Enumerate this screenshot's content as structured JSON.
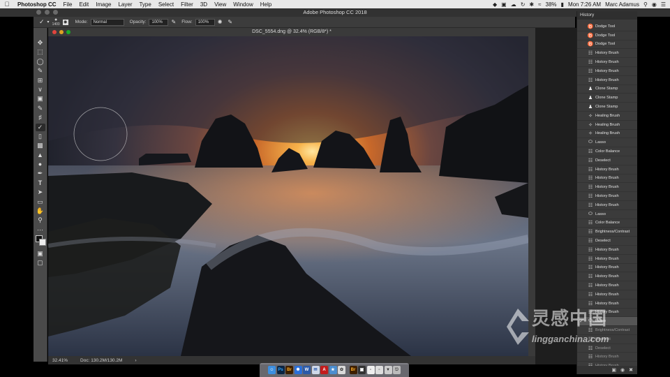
{
  "menubar": {
    "app_name": "Photoshop CC",
    "menus": [
      "File",
      "Edit",
      "Image",
      "Layer",
      "Type",
      "Select",
      "Filter",
      "3D",
      "View",
      "Window",
      "Help"
    ],
    "battery": "38%",
    "clock": "Mon 7:26 AM",
    "user": "Marc Adamus"
  },
  "app": {
    "title": "Adobe Photoshop CC 2018"
  },
  "options": {
    "brush_size": "1400",
    "mode_label": "Mode:",
    "mode_value": "Normal",
    "opacity_label": "Opacity:",
    "opacity_value": "100%",
    "flow_label": "Flow:",
    "flow_value": "100%"
  },
  "document": {
    "title": "DSC_5554.dng @ 32.4% (RGB/8*) *",
    "zoom": "32.41%",
    "doc_size": "Doc: 130.2M/130.2M"
  },
  "history": {
    "title": "History",
    "items": [
      {
        "label": "Dodge Tool",
        "icon": "dodge-icon"
      },
      {
        "label": "Dodge Tool",
        "icon": "dodge-icon"
      },
      {
        "label": "Dodge Tool",
        "icon": "dodge-icon"
      },
      {
        "label": "History Brush",
        "icon": "history-brush-icon"
      },
      {
        "label": "History Brush",
        "icon": "history-brush-icon"
      },
      {
        "label": "History Brush",
        "icon": "history-brush-icon"
      },
      {
        "label": "History Brush",
        "icon": "history-brush-icon"
      },
      {
        "label": "Clone Stamp",
        "icon": "clone-stamp-icon"
      },
      {
        "label": "Clone Stamp",
        "icon": "clone-stamp-icon"
      },
      {
        "label": "Clone Stamp",
        "icon": "clone-stamp-icon"
      },
      {
        "label": "Healing Brush",
        "icon": "healing-brush-icon"
      },
      {
        "label": "Healing Brush",
        "icon": "healing-brush-icon"
      },
      {
        "label": "Healing Brush",
        "icon": "healing-brush-icon"
      },
      {
        "label": "Lasso",
        "icon": "lasso-icon"
      },
      {
        "label": "Color Balance",
        "icon": "adjustment-icon"
      },
      {
        "label": "Deselect",
        "icon": "adjustment-icon"
      },
      {
        "label": "History Brush",
        "icon": "history-brush-icon"
      },
      {
        "label": "History Brush",
        "icon": "history-brush-icon"
      },
      {
        "label": "History Brush",
        "icon": "history-brush-icon"
      },
      {
        "label": "History Brush",
        "icon": "history-brush-icon"
      },
      {
        "label": "History Brush",
        "icon": "history-brush-icon"
      },
      {
        "label": "Lasso",
        "icon": "lasso-icon"
      },
      {
        "label": "Color Balance",
        "icon": "adjustment-icon"
      },
      {
        "label": "Brightness/Contrast",
        "icon": "adjustment-icon"
      },
      {
        "label": "Deselect",
        "icon": "adjustment-icon"
      },
      {
        "label": "History Brush",
        "icon": "history-brush-icon"
      },
      {
        "label": "History Brush",
        "icon": "history-brush-icon"
      },
      {
        "label": "History Brush",
        "icon": "history-brush-icon"
      },
      {
        "label": "History Brush",
        "icon": "history-brush-icon"
      },
      {
        "label": "History Brush",
        "icon": "history-brush-icon"
      },
      {
        "label": "History Brush",
        "icon": "history-brush-icon"
      },
      {
        "label": "History Brush",
        "icon": "history-brush-icon"
      },
      {
        "label": "History Brush",
        "icon": "history-brush-icon"
      },
      {
        "label": "Lasso",
        "icon": "lasso-icon"
      },
      {
        "label": "Brightness/Contrast",
        "icon": "adjustment-icon"
      },
      {
        "label": "Deselect",
        "icon": "adjustment-icon"
      },
      {
        "label": "Deselect",
        "icon": "adjustment-icon"
      },
      {
        "label": "History Brush",
        "icon": "history-brush-icon"
      },
      {
        "label": "History Brush",
        "icon": "history-brush-icon"
      }
    ],
    "current_index": 33
  },
  "watermark": {
    "cn": "灵感中国",
    "en": "lingganchina.com"
  },
  "colors": {
    "accent": "#4a8de0",
    "panel": "#3b3b3b"
  }
}
